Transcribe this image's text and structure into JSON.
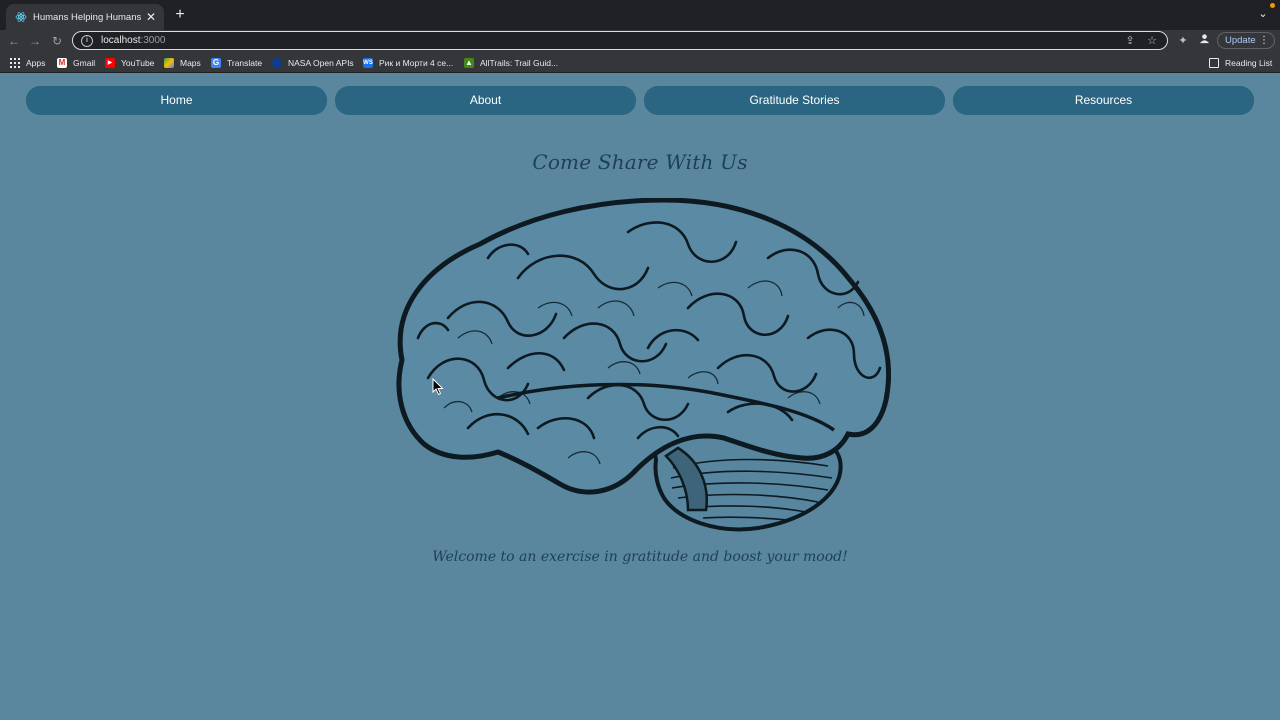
{
  "browser": {
    "tab": {
      "title": "Humans Helping Humans"
    },
    "address": {
      "host": "localhost",
      "port": ":3000"
    },
    "update_label": "Update",
    "bookmarks": [
      {
        "label": "Apps",
        "icon": "apps-grid-icon"
      },
      {
        "label": "Gmail",
        "icon": "gmail-icon"
      },
      {
        "label": "YouTube",
        "icon": "youtube-icon"
      },
      {
        "label": "Maps",
        "icon": "maps-icon"
      },
      {
        "label": "Translate",
        "icon": "translate-icon"
      },
      {
        "label": "NASA Open APIs",
        "icon": "nasa-icon"
      },
      {
        "label": "Рик и Морти 4 се...",
        "icon": "ws-icon"
      },
      {
        "label": "AllTrails: Trail Guid...",
        "icon": "alltrails-icon"
      }
    ],
    "reading_list": "Reading List"
  },
  "nav": {
    "items": [
      {
        "label": "Home"
      },
      {
        "label": "About"
      },
      {
        "label": "Gratitude Stories"
      },
      {
        "label": "Resources"
      }
    ]
  },
  "hero": {
    "headline": "Come Share With Us",
    "tagline": "Welcome to an exercise in gratitude and boost your mood!"
  },
  "colors": {
    "page_bg": "#5a879e",
    "nav_pill": "#2a6582",
    "heading_text": "#1f3f55",
    "brain_fill": "#5a8aa4",
    "brain_ink": "#0d1a22"
  }
}
